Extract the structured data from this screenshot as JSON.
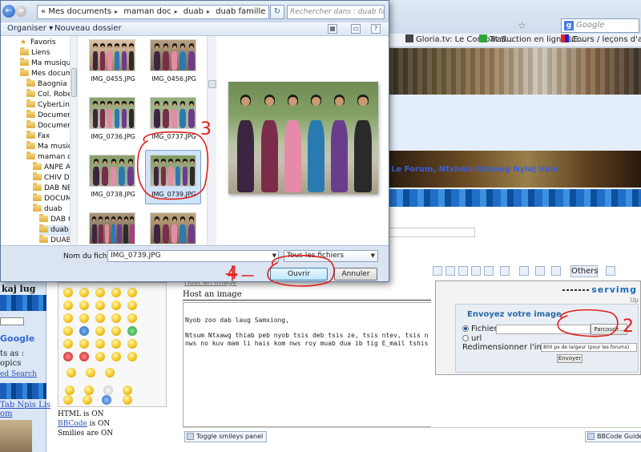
{
  "dialog": {
    "address_segments": [
      "Mes documents",
      "maman doc",
      "duab",
      "duab famille"
    ],
    "search_placeholder": "Rechercher dans : duab famille",
    "toolbar": {
      "organize": "Organiser",
      "new_folder": "Nouveau dossier"
    },
    "tree": [
      {
        "label": "Favoris",
        "icon": "star-icon",
        "indent": 0
      },
      {
        "label": "Liens",
        "icon": "folder-icon",
        "indent": 0
      },
      {
        "label": "Ma musique",
        "icon": "folder-icon",
        "indent": 0
      },
      {
        "label": "Mes documents",
        "icon": "folder-icon",
        "indent": 0
      },
      {
        "label": "Baognia",
        "icon": "folder-icon",
        "indent": 1
      },
      {
        "label": "Col. Robert Ja",
        "icon": "folder-icon",
        "indent": 1
      },
      {
        "label": "CyberLink",
        "icon": "folder-icon",
        "indent": 1
      },
      {
        "label": "Documents r",
        "icon": "folder-icon",
        "indent": 1
      },
      {
        "label": "Documents p",
        "icon": "folder-icon",
        "indent": 1
      },
      {
        "label": "Fax",
        "icon": "folder-icon",
        "indent": 1
      },
      {
        "label": "Ma musique",
        "icon": "folder-icon",
        "indent": 1
      },
      {
        "label": "maman doc",
        "icon": "folder-icon",
        "indent": 1
      },
      {
        "label": "ANPE ASSE",
        "icon": "folder-icon",
        "indent": 2
      },
      {
        "label": "CHIV DUAB",
        "icon": "folder-icon",
        "indent": 2
      },
      {
        "label": "DAB NEEG",
        "icon": "folder-icon",
        "indent": 2
      },
      {
        "label": "DOCUMEN",
        "icon": "folder-icon",
        "indent": 2
      },
      {
        "label": "duab",
        "icon": "folder-icon",
        "indent": 2
      },
      {
        "label": "DAB QHU",
        "icon": "folder-icon",
        "indent": 3
      },
      {
        "label": "duab fam",
        "icon": "folder-icon",
        "indent": 3,
        "selected": true
      },
      {
        "label": "DUAB HN",
        "icon": "folder-icon",
        "indent": 3
      }
    ],
    "files": [
      {
        "name": "IMG_0455.JPG"
      },
      {
        "name": "IMG_0456.JPG"
      },
      {
        "name": "IMG_0736.JPG"
      },
      {
        "name": "IMG_0737.JPG"
      },
      {
        "name": "IMG_0738.JPG"
      },
      {
        "name": "IMG_0739.JPG",
        "selected": true
      },
      {
        "name": ""
      },
      {
        "name": ""
      }
    ],
    "filename_label": "Nom du fichier :",
    "filename_value": "IMG_0739.JPG",
    "filetype": "Tous les fichiers",
    "open_button": "Ouvrir",
    "cancel_button": "Annuler"
  },
  "browser": {
    "search_placeholder": "Google",
    "bookmarks": [
      "Gloria.tv: Le Combat S...",
      "Traduction en ligne LE...",
      "Cours / leçons d'angla..."
    ]
  },
  "forum": {
    "left_title": "kaj lug",
    "left_google": "Google",
    "left_texts": [
      "ts as :",
      "opics"
    ],
    "left_link": "ed Search",
    "left_bottom_links": [
      "Tab Npis Lis",
      "om"
    ],
    "host_tab": "Host an image",
    "host_label": "Host an image",
    "editor_lines": [
      "Nyob zoo dab laug Samxiong,",
      "Ntsum Ntxawg thiab peb nyob tsis deb tsis ze, tsis ntev, tsis n",
      "nws no kuv mam li hais kom nws roy muab dua ib tig E_mail tshis"
    ],
    "info": {
      "html": "HTML is ON",
      "bbcode_link": "BBCode",
      "bbcode_rest": " is ON",
      "smilies": "Smilies are ON"
    },
    "others_button": "Others",
    "toggle_smileys": "Toggle smileys panel",
    "bbcode_guide": "BBCode Guide",
    "stripe_link": "Le Forum, Ntxhais Ntxawg Nyiaj Vam"
  },
  "servimg": {
    "logo": "servimg",
    "up": "Up",
    "title": "Envoyez votre image",
    "option_file": "Fichier",
    "option_url": "url",
    "browse_button": "Parcourir...",
    "resize_label": "Redimensionner l'image",
    "resize_value": "800 px de largeur (pour les forums)",
    "send_button": "Envoyer"
  },
  "annotations": [
    "3",
    "4",
    "2"
  ],
  "colors": {
    "accent": "#2d6aa6",
    "annotation": "#e0201c",
    "selection": "#cfe3fb"
  }
}
